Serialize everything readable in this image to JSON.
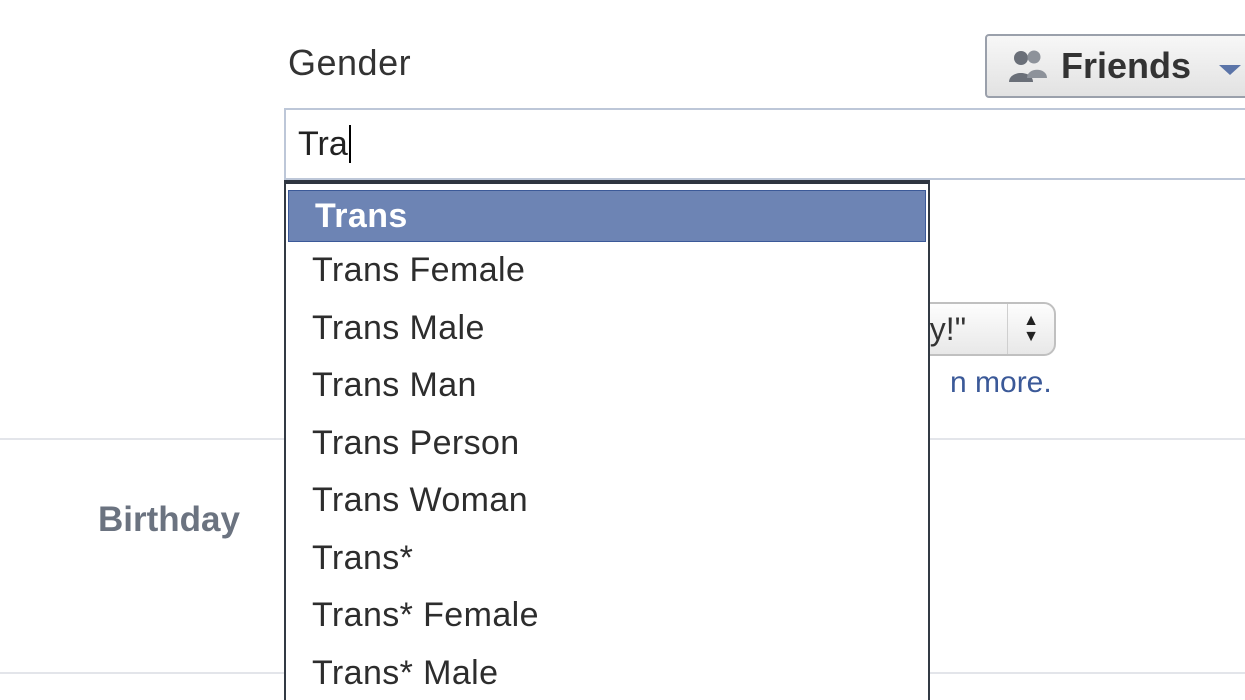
{
  "audience": {
    "label": "Friends",
    "icon": "friends-icon"
  },
  "gender": {
    "label": "Gender",
    "input_value": "Tra",
    "suggestions": [
      "Trans",
      "Trans Female",
      "Trans Male",
      "Trans Man",
      "Trans Person",
      "Trans Woman",
      "Trans*",
      "Trans* Female",
      "Trans* Male"
    ],
    "highlighted_index": 0
  },
  "pronoun": {
    "selected_fragment": "ay!\""
  },
  "learn_more_fragment": "n more.",
  "birthday": {
    "label": "Birthday"
  },
  "colors": {
    "highlight": "#6d84b4",
    "link": "#3b5998"
  }
}
